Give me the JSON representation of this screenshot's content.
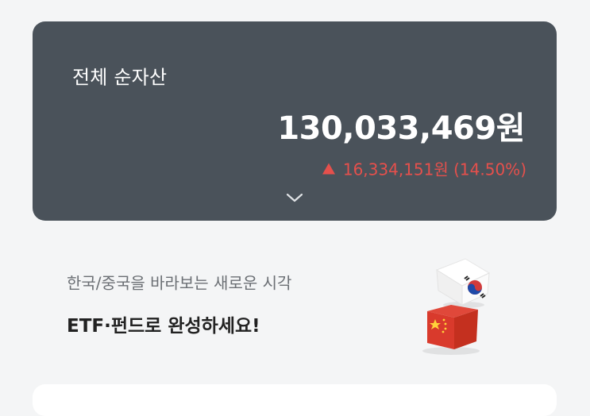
{
  "asset_summary": {
    "title": "전체 순자산",
    "total_amount": "130,033,469원",
    "change_text": "16,334,151원 (14.50%)",
    "change_direction_icon": "triangle-up-icon",
    "expand_icon": "chevron-down-icon",
    "change_color": "#e5504c",
    "card_color": "#4a525a"
  },
  "promo": {
    "subtitle": "한국/중국을 바라보는 새로운 시각",
    "headline": "ETF·펀드로 완성하세요!",
    "images": [
      "korea-flag-cube-icon",
      "china-flag-cube-icon"
    ]
  }
}
